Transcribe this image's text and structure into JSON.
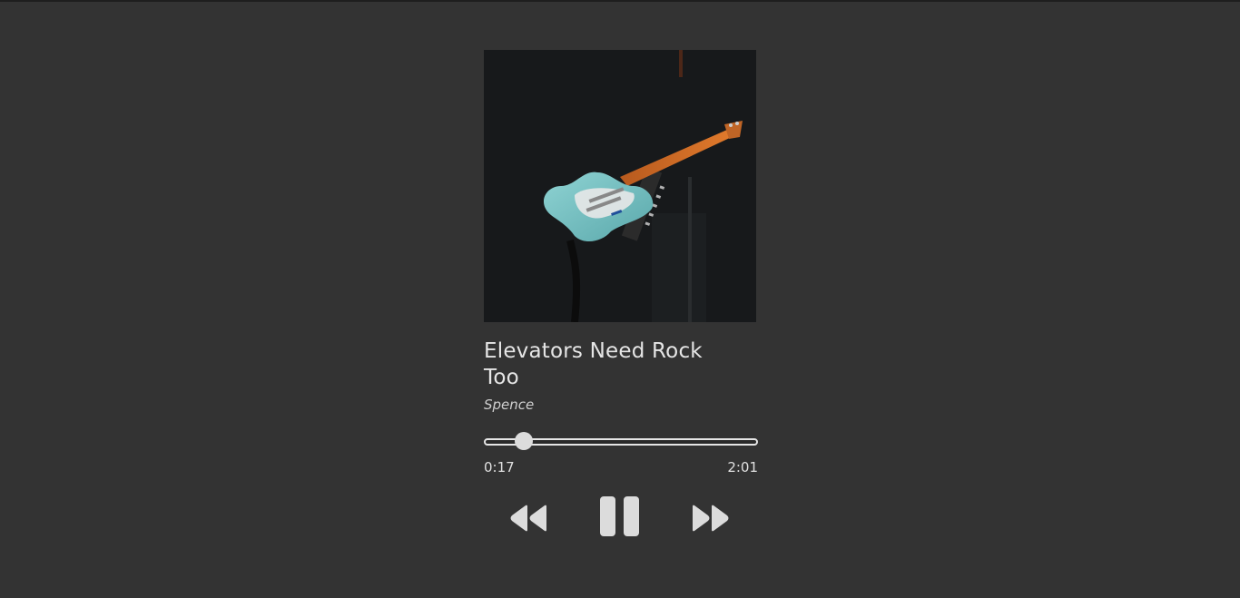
{
  "track": {
    "title": "Elevators Need Rock Too",
    "artist": "Spence"
  },
  "cover": {
    "icon": "guitar-album-art",
    "alt": "Album cover showing a guitar"
  },
  "progress": {
    "current_time": "0:17",
    "total_time": "2:01",
    "fraction": 0.14
  },
  "controls": {
    "prev_icon": "rewind-icon",
    "play_icon": "pause-icon",
    "next_icon": "fast-forward-icon"
  },
  "colors": {
    "background": "#333333",
    "text": "#e6e6e6",
    "icon": "#dcdcdc"
  }
}
